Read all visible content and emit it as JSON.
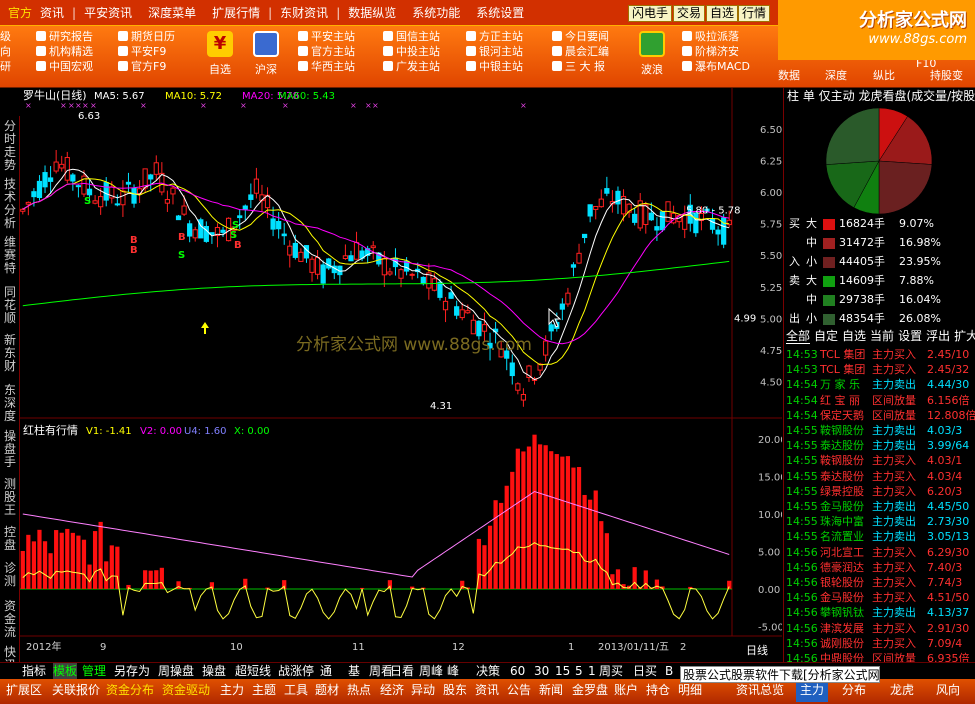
{
  "menubar": {
    "items": [
      "官方",
      "资讯",
      "平安资讯",
      "深度菜单",
      "扩展行情",
      "东财资讯",
      "数据纵览",
      "系统功能",
      "系统设置"
    ],
    "quick": [
      "闪电手",
      "交易",
      "自选",
      "行情"
    ]
  },
  "brand": {
    "line1": "分析家公式网",
    "line2": "www.88gs.com"
  },
  "toolbar": {
    "col0": [
      "级",
      "向",
      "研"
    ],
    "col1": [
      "研究报告",
      "机构精选",
      "中国宏观"
    ],
    "col2": [
      "期货日历",
      "平安F9",
      "官方F9"
    ],
    "btn_zixuan": "自选",
    "btn_hushen": "沪深",
    "col3": [
      "平安主站",
      "官方主站",
      "华西主站"
    ],
    "col4": [
      "国信主站",
      "中投主站",
      "广发主站"
    ],
    "col5": [
      "方正主站",
      "银河主站",
      "中银主站"
    ],
    "col6": [
      "今日要闻",
      "晨会汇编",
      "三 大 报"
    ],
    "btn_bolang": "波浪",
    "col7": [
      "吸拉派落",
      "阶梯济安",
      "瀑布MACD"
    ],
    "right": [
      "数据",
      "深度",
      "纵比",
      "F10",
      "持股变"
    ]
  },
  "leftnav": [
    "分时走势",
    "技术分析",
    "维赛特",
    "同花顺",
    "新东财",
    "东深度",
    "操盘手",
    "测股王",
    "控盘",
    "诊测",
    "资金流",
    "快讯"
  ],
  "chart": {
    "title": "罗牛山(日线)",
    "ma": [
      {
        "label": "MA5: 5.67",
        "color": "#ffffff"
      },
      {
        "label": "MA10: 5.72",
        "color": "#ffff00"
      },
      {
        "label": "MA20: 5.78",
        "color": "#ff00ff"
      },
      {
        "label": "MA60: 5.43",
        "color": "#00ff00"
      }
    ],
    "y_ticks": [
      "6.50",
      "6.25",
      "6.00",
      "5.75",
      "5.50",
      "5.25",
      "5.00",
      "4.75",
      "4.50"
    ],
    "price_labels": {
      "high": "6.63",
      "low": "4.31",
      "right": "5.80 - 5.78",
      "cur": "4.99"
    },
    "watermark": "分析家公式网 www.88gs.com",
    "indicator": {
      "title": "红柱有行情",
      "v1": "V1: -1.41",
      "v2": "V2: 0.00",
      "u4": "U4: 1.60",
      "x": "X: 0.00"
    },
    "ind_ticks": [
      "20.00",
      "15.00",
      "10.00",
      "5.00",
      "0.00",
      "-5.00"
    ],
    "x_labels": [
      "2012年",
      "9",
      "10",
      "11",
      "12",
      "1",
      "2013/01/11/五",
      "2"
    ],
    "period": "日线",
    "signals": [
      "S",
      "B",
      "B",
      "S",
      "S",
      "B",
      "S",
      "B"
    ]
  },
  "chart_data": [
    {
      "type": "candlestick",
      "title": "罗牛山(日线)",
      "ylim": [
        4.25,
        6.65
      ],
      "series": [
        {
          "name": "MA5",
          "values": [
            5.67
          ]
        },
        {
          "name": "MA10",
          "values": [
            5.72
          ]
        },
        {
          "name": "MA20",
          "values": [
            5.78
          ]
        },
        {
          "name": "MA60",
          "values": [
            5.43
          ]
        }
      ],
      "annotations": [
        "6.63",
        "4.31",
        "5.80 - 5.78",
        "4.99"
      ]
    },
    {
      "type": "bar",
      "title": "红柱有行情",
      "ylim": [
        -5,
        22
      ],
      "series": [
        {
          "name": "V1",
          "values": [
            -1.41
          ]
        },
        {
          "name": "V2",
          "values": [
            0.0
          ]
        },
        {
          "name": "U4",
          "values": [
            1.6
          ]
        },
        {
          "name": "X",
          "values": [
            0.0
          ]
        }
      ]
    }
  ],
  "right": {
    "tabs": "柱 单 仅主动 龙虎看盘(成交量/按股",
    "pie": [
      {
        "v": 16824,
        "c": "#cc1010"
      },
      {
        "v": 31472,
        "c": "#9a1a1a"
      },
      {
        "v": 44405,
        "c": "#6a2020"
      },
      {
        "v": 14609,
        "c": "#108010"
      },
      {
        "v": 29738,
        "c": "#186818"
      },
      {
        "v": 48354,
        "c": "#2a5a2a"
      }
    ],
    "flow": [
      {
        "l1": "买",
        "l2": "大",
        "vol": "16824手",
        "pct": "9.07%",
        "c": "#dd1010"
      },
      {
        "l1": "",
        "l2": "中",
        "vol": "31472手",
        "pct": "16.98%",
        "c": "#a02020"
      },
      {
        "l1": "入",
        "l2": "小",
        "vol": "44405手",
        "pct": "23.95%",
        "c": "#702020"
      },
      {
        "l1": "卖",
        "l2": "大",
        "vol": "14609手",
        "pct": "7.88%",
        "c": "#10a010"
      },
      {
        "l1": "",
        "l2": "中",
        "vol": "29738手",
        "pct": "16.04%",
        "c": "#208020"
      },
      {
        "l1": "出",
        "l2": "小",
        "vol": "48354手",
        "pct": "26.08%",
        "c": "#306030"
      }
    ],
    "tabs2": [
      "全部",
      "自定",
      "自选",
      "当前",
      "设置",
      "浮出",
      "扩大"
    ],
    "trades": [
      {
        "t": "14:53",
        "n": "TCL 集团",
        "a": "主力买入",
        "v": "2.45/10",
        "buy": true
      },
      {
        "t": "14:53",
        "n": "TCL 集团",
        "a": "主力买入",
        "v": "2.45/32",
        "buy": true
      },
      {
        "t": "14:54",
        "n": "万 家 乐",
        "a": "主力卖出",
        "v": "4.44/30",
        "buy": false
      },
      {
        "t": "14:54",
        "n": "红 宝 丽",
        "a": "区间放量",
        "v": "6.156倍",
        "buy": true
      },
      {
        "t": "14:54",
        "n": "保定天鹅",
        "a": "区间放量",
        "v": "12.808倍",
        "buy": true
      },
      {
        "t": "14:55",
        "n": "鞍钢股份",
        "a": "主力卖出",
        "v": "4.03/3",
        "buy": false
      },
      {
        "t": "14:55",
        "n": "泰达股份",
        "a": "主力卖出",
        "v": "3.99/64",
        "buy": false
      },
      {
        "t": "14:55",
        "n": "鞍钢股份",
        "a": "主力买入",
        "v": "4.03/1",
        "buy": true
      },
      {
        "t": "14:55",
        "n": "泰达股份",
        "a": "主力买入",
        "v": "4.03/4",
        "buy": true
      },
      {
        "t": "14:55",
        "n": "绿景控股",
        "a": "主力买入",
        "v": "6.20/3",
        "buy": true
      },
      {
        "t": "14:55",
        "n": "金马股份",
        "a": "主力卖出",
        "v": "4.45/50",
        "buy": false
      },
      {
        "t": "14:55",
        "n": "珠海中富",
        "a": "主力卖出",
        "v": "2.73/30",
        "buy": false
      },
      {
        "t": "14:55",
        "n": "名流置业",
        "a": "主力卖出",
        "v": "3.05/13",
        "buy": false
      },
      {
        "t": "14:56",
        "n": "河北宣工",
        "a": "主力买入",
        "v": "6.29/30",
        "buy": true
      },
      {
        "t": "14:56",
        "n": "德豪润达",
        "a": "主力买入",
        "v": "7.40/3",
        "buy": true
      },
      {
        "t": "14:56",
        "n": "银轮股份",
        "a": "主力买入",
        "v": "7.74/3",
        "buy": true
      },
      {
        "t": "14:56",
        "n": "金马股份",
        "a": "主力买入",
        "v": "4.51/50",
        "buy": true
      },
      {
        "t": "14:56",
        "n": "攀钢钒钛",
        "a": "主力卖出",
        "v": "4.13/37",
        "buy": false
      },
      {
        "t": "14:56",
        "n": "津滨发展",
        "a": "主力买入",
        "v": "2.91/30",
        "buy": true
      },
      {
        "t": "14:56",
        "n": "诚刚股份",
        "a": "主力买入",
        "v": "7.09/4",
        "buy": true
      },
      {
        "t": "14:56",
        "n": "中鼎股份",
        "a": "区间放量",
        "v": "6.935倍",
        "buy": true
      }
    ]
  },
  "bottom1": [
    "指标",
    "模板",
    "管理",
    "另存为",
    "周操盘",
    "操盘",
    "超短线",
    "战涨停",
    "通",
    "基",
    "周看",
    "日看",
    "周峰",
    "峰",
    "决策",
    "60",
    "30",
    "15",
    "5",
    "1",
    "周买",
    "日买",
    "B"
  ],
  "bottom2": [
    "扩展区",
    "关联报价",
    "资金分布",
    "资金驱动",
    "主力",
    "主题",
    "工具",
    "题材",
    "热点",
    "经济",
    "异动",
    "股东",
    "资讯",
    "公告",
    "新闻",
    "金罗盘",
    "账户",
    "持仓",
    "明细",
    "资讯总览",
    "主力",
    "分布",
    "龙虎",
    "风向"
  ],
  "ad": "股票公式股票软件下载[分析家公式网www.88gs.com]"
}
